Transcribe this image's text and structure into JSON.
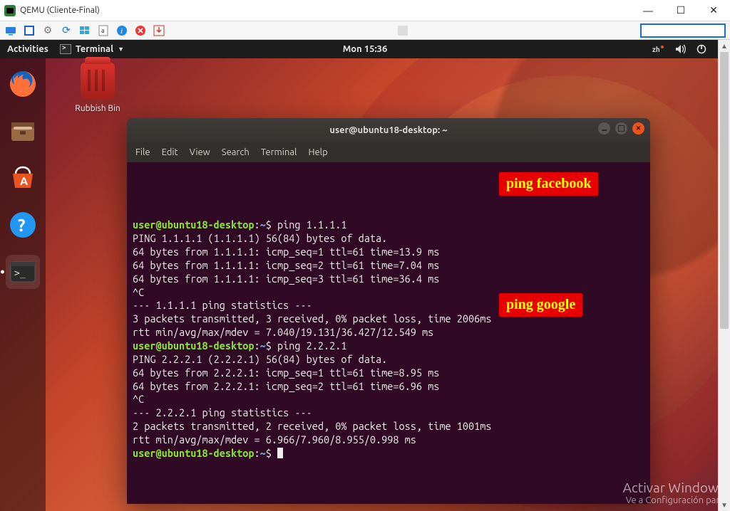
{
  "window": {
    "title": "QEMU (Cliente-Final)",
    "min_tip": "Minimize",
    "max_tip": "Maximize",
    "close_tip": "Close"
  },
  "gnome": {
    "activities": "Activities",
    "app_menu": "Terminal",
    "clock": "Mon 15:36"
  },
  "desktop": {
    "trash_label": "Rubbish Bin"
  },
  "terminal": {
    "title": "user@ubuntu18-desktop: ~",
    "menus": [
      "File",
      "Edit",
      "View",
      "Search",
      "Terminal",
      "Help"
    ],
    "prompt": {
      "userhost": "user@ubuntu18-desktop",
      "path": "~",
      "sep1": ":",
      "sep2": "$"
    },
    "session": [
      {
        "type": "cmd",
        "text": "ping 1.1.1.1"
      },
      {
        "type": "out",
        "text": "PING 1.1.1.1 (1.1.1.1) 56(84) bytes of data."
      },
      {
        "type": "out",
        "text": "64 bytes from 1.1.1.1: icmp_seq=1 ttl=61 time=13.9 ms"
      },
      {
        "type": "out",
        "text": "64 bytes from 1.1.1.1: icmp_seq=2 ttl=61 time=7.04 ms"
      },
      {
        "type": "out",
        "text": "64 bytes from 1.1.1.1: icmp_seq=3 ttl=61 time=36.4 ms"
      },
      {
        "type": "out",
        "text": "^C"
      },
      {
        "type": "out",
        "text": "--- 1.1.1.1 ping statistics ---"
      },
      {
        "type": "out",
        "text": "3 packets transmitted, 3 received, 0% packet loss, time 2006ms"
      },
      {
        "type": "out",
        "text": "rtt min/avg/max/mdev = 7.040/19.131/36.427/12.549 ms"
      },
      {
        "type": "cmd",
        "text": "ping 2.2.2.1"
      },
      {
        "type": "out",
        "text": "PING 2.2.2.1 (2.2.2.1) 56(84) bytes of data."
      },
      {
        "type": "out",
        "text": "64 bytes from 2.2.2.1: icmp_seq=1 ttl=61 time=8.95 ms"
      },
      {
        "type": "out",
        "text": "64 bytes from 2.2.2.1: icmp_seq=2 ttl=61 time=6.96 ms"
      },
      {
        "type": "out",
        "text": "^C"
      },
      {
        "type": "out",
        "text": "--- 2.2.2.1 ping statistics ---"
      },
      {
        "type": "out",
        "text": "2 packets transmitted, 2 received, 0% packet loss, time 1001ms"
      },
      {
        "type": "out",
        "text": "rtt min/avg/max/mdev = 6.966/7.960/8.955/0.998 ms"
      },
      {
        "type": "cmd",
        "text": ""
      }
    ]
  },
  "annotations": {
    "a1": "ping facebook",
    "a2": "ping google"
  },
  "watermark": {
    "line1": "Activar Windows",
    "line2": "Ve a Configuración para"
  }
}
